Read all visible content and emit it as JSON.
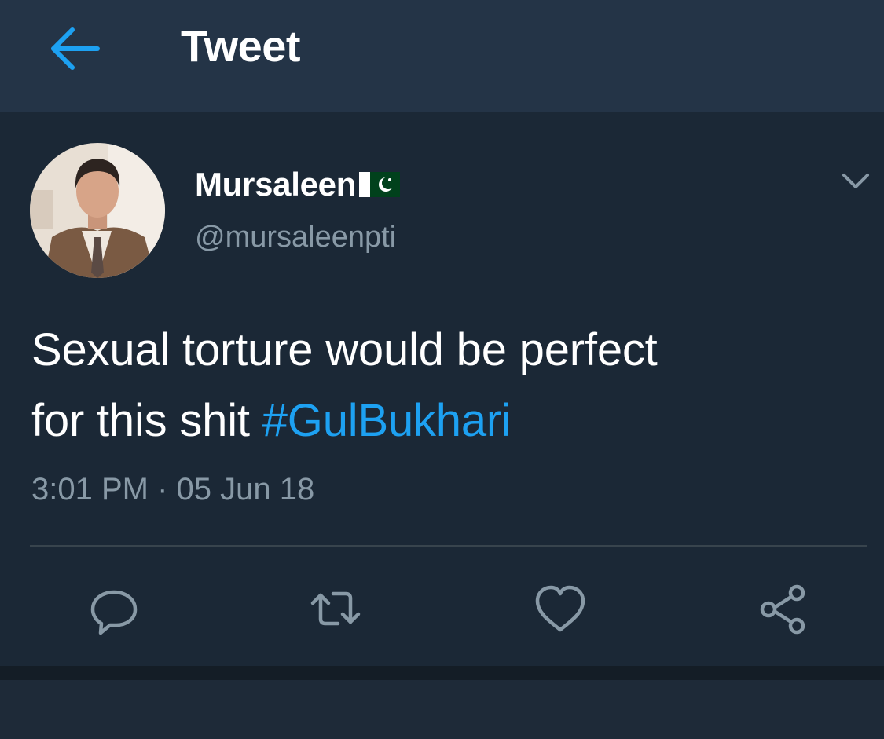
{
  "header": {
    "back_icon": "arrow-left-icon",
    "title": "Tweet",
    "accent_color": "#1da1f2"
  },
  "tweet": {
    "author": {
      "display_name": "Mursaleen",
      "flag_icon": "pakistan-flag-icon",
      "handle": "@mursaleenpti"
    },
    "menu_icon": "chevron-down-icon",
    "text_line1": "Sexual torture would be perfect",
    "text_line2": "for this shit",
    "hashtag": "#GulBukhari",
    "timestamp": "3:01 PM · 05 Jun 18",
    "actions": [
      {
        "name": "reply",
        "icon": "reply-icon"
      },
      {
        "name": "retweet",
        "icon": "retweet-icon"
      },
      {
        "name": "like",
        "icon": "heart-icon"
      },
      {
        "name": "share",
        "icon": "share-icon"
      }
    ]
  },
  "colors": {
    "header_bg": "#243447",
    "tweet_bg": "#1b2836",
    "text_primary": "#ffffff",
    "text_secondary": "#8899a6",
    "hashtag": "#1da1f2"
  }
}
